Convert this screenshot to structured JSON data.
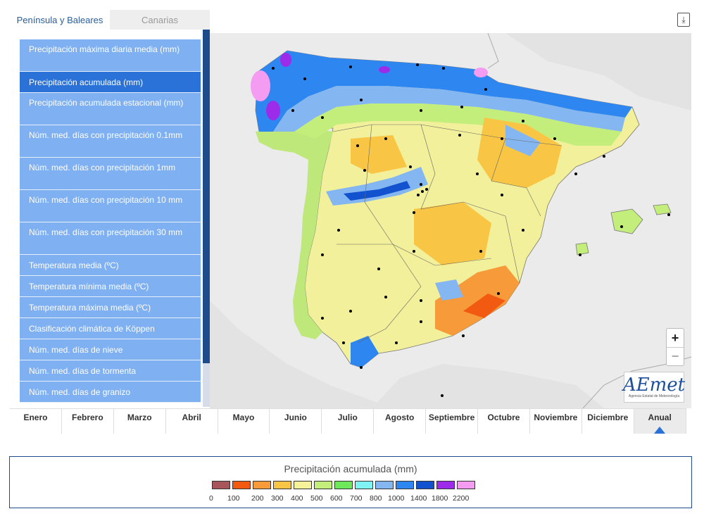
{
  "tabs": [
    {
      "label": "Península y Baleares",
      "active": true
    },
    {
      "label": "Canarias",
      "active": false
    }
  ],
  "menu": [
    {
      "label": "Precipitación máxima diaria media (mm)",
      "lines": 2
    },
    {
      "label": "Precipitación acumulada (mm)",
      "lines": 1,
      "selected": true
    },
    {
      "label": "Precipitación acumulada estacional (mm)",
      "lines": 2
    },
    {
      "label": "Núm. med. días con precipitación 0.1mm",
      "lines": 2
    },
    {
      "label": "Núm. med. días con precipitación 1mm",
      "lines": 2
    },
    {
      "label": "Núm. med. días con precipitación 10 mm",
      "lines": 2
    },
    {
      "label": "Núm. med. días con precipitación 30 mm",
      "lines": 2
    },
    {
      "label": "Temperatura media (ºC)",
      "lines": 1
    },
    {
      "label": "Temperatura mínima media (ºC)",
      "lines": 1
    },
    {
      "label": "Temperatura máxima media (ºC)",
      "lines": 1
    },
    {
      "label": "Clasificación climática de Köppen",
      "lines": 1
    },
    {
      "label": "Núm. med. días de nieve",
      "lines": 1
    },
    {
      "label": "Núm. med. días de tormenta",
      "lines": 1
    },
    {
      "label": "Núm. med. días de granizo",
      "lines": 1
    }
  ],
  "months": [
    "Enero",
    "Febrero",
    "Marzo",
    "Abril",
    "Mayo",
    "Junio",
    "Julio",
    "Agosto",
    "Septiembre",
    "Octubre",
    "Noviembre",
    "Diciembre",
    "Anual"
  ],
  "active_month": "Anual",
  "zoom": {
    "in": "+",
    "out": "−"
  },
  "logo": {
    "text": "AEmet",
    "subtitle": "Agencia Estatal de Meteorología"
  },
  "download_icon": "download-icon",
  "legend": {
    "title": "Precipitación acumulada (mm)",
    "colors": [
      "#a8565b",
      "#f25a12",
      "#f79a3a",
      "#f9c544",
      "#f6f29a",
      "#c4ee7c",
      "#6ee85a",
      "#7ef3f1",
      "#84b6f2",
      "#2e86f0",
      "#1252cf",
      "#9d2bea",
      "#f49cf2"
    ],
    "labels": [
      "0",
      "100",
      "200",
      "300",
      "400",
      "500",
      "600",
      "700",
      "800",
      "1000",
      "1400",
      "1800",
      "2200"
    ]
  }
}
